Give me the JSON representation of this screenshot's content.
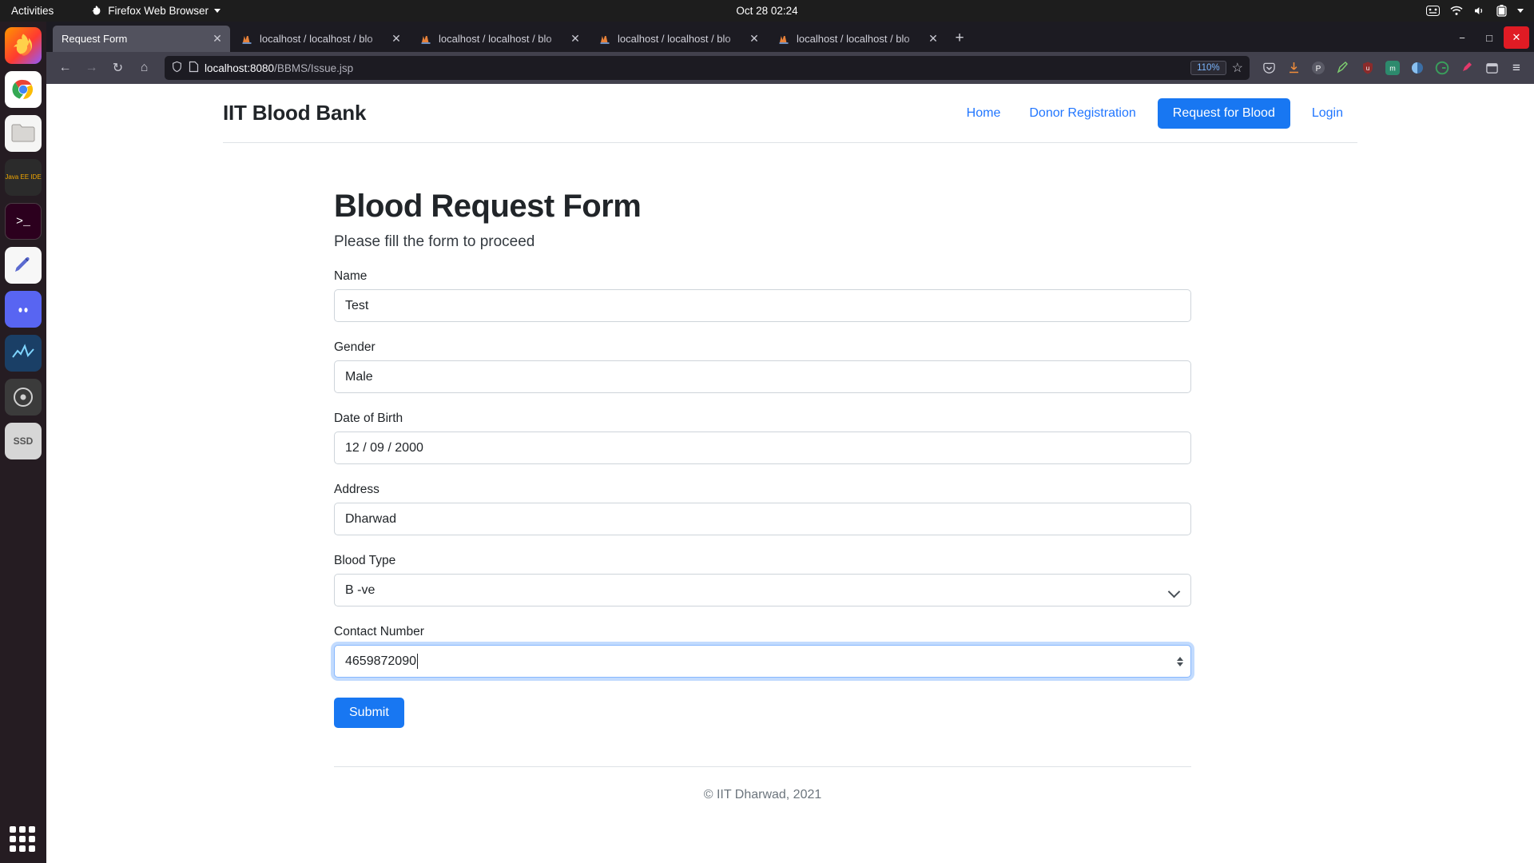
{
  "os": {
    "activities": "Activities",
    "app_menu": "Firefox Web Browser",
    "clock": "Oct 28  02:24",
    "tray_icons": [
      "media-icon",
      "wifi-icon",
      "volume-icon",
      "battery-icon",
      "power-chevron-icon"
    ],
    "dock_items": [
      {
        "name": "firefox",
        "label": ""
      },
      {
        "name": "chrome",
        "label": ""
      },
      {
        "name": "files",
        "label": ""
      },
      {
        "name": "netbeans",
        "label": "Java EE IDE"
      },
      {
        "name": "terminal",
        "label": ""
      },
      {
        "name": "text-editor",
        "label": ""
      },
      {
        "name": "discord",
        "label": ""
      },
      {
        "name": "matlab",
        "label": ""
      },
      {
        "name": "disks",
        "label": ""
      },
      {
        "name": "ssd-drive",
        "label": "SSD"
      }
    ]
  },
  "browser": {
    "tabs": [
      {
        "title": "Request Form",
        "active": true,
        "favicon": "none"
      },
      {
        "title": "localhost / localhost / blo",
        "active": false,
        "favicon": "phpmyadmin-icon"
      },
      {
        "title": "localhost / localhost / blo",
        "active": false,
        "favicon": "phpmyadmin-icon"
      },
      {
        "title": "localhost / localhost / blo",
        "active": false,
        "favicon": "phpmyadmin-icon"
      },
      {
        "title": "localhost / localhost / blo",
        "active": false,
        "favicon": "phpmyadmin-icon"
      }
    ],
    "new_tab_label": "+",
    "window_controls": {
      "minimize": "−",
      "maximize": "□",
      "close": "✕"
    },
    "toolbar": {
      "back": "←",
      "forward": "→",
      "reload": "↻",
      "home": "⌂",
      "url_host": "localhost:8080",
      "url_path": "/BBMS/Issue.jsp",
      "zoom_level": "110%",
      "bookmark": "☆",
      "menu": "≡"
    },
    "extensions": [
      "pocket-icon",
      "downloads-icon",
      "pocket-p-icon",
      "styles-icon",
      "ublock-icon",
      "metamask-icon",
      "dark-reader-icon",
      "grammarly-icon",
      "highlighter-icon",
      "library-icon"
    ]
  },
  "site": {
    "brand": "IIT Blood Bank",
    "nav": [
      {
        "label": "Home",
        "style": "link"
      },
      {
        "label": "Donor Registration",
        "style": "link"
      },
      {
        "label": "Request for Blood",
        "style": "cta"
      },
      {
        "label": "Login",
        "style": "link"
      }
    ],
    "heading": "Blood Request Form",
    "subheading": "Please fill the form to proceed",
    "fields": [
      {
        "label": "Name",
        "value": "Test",
        "type": "text",
        "focused": false
      },
      {
        "label": "Gender",
        "value": "Male",
        "type": "text",
        "focused": false
      },
      {
        "label": "Date of Birth",
        "value": "12 / 09 / 2000",
        "type": "date",
        "focused": false
      },
      {
        "label": "Address",
        "value": "Dharwad",
        "type": "text",
        "focused": false
      },
      {
        "label": "Blood Type",
        "value": "B -ve",
        "type": "select",
        "focused": false
      },
      {
        "label": "Contact Number",
        "value": "4659872090",
        "type": "number",
        "focused": true
      }
    ],
    "submit_label": "Submit",
    "footer": "© IIT Dharwad, 2021",
    "accent_color": "#1877f2",
    "link_color": "#2176ff"
  }
}
